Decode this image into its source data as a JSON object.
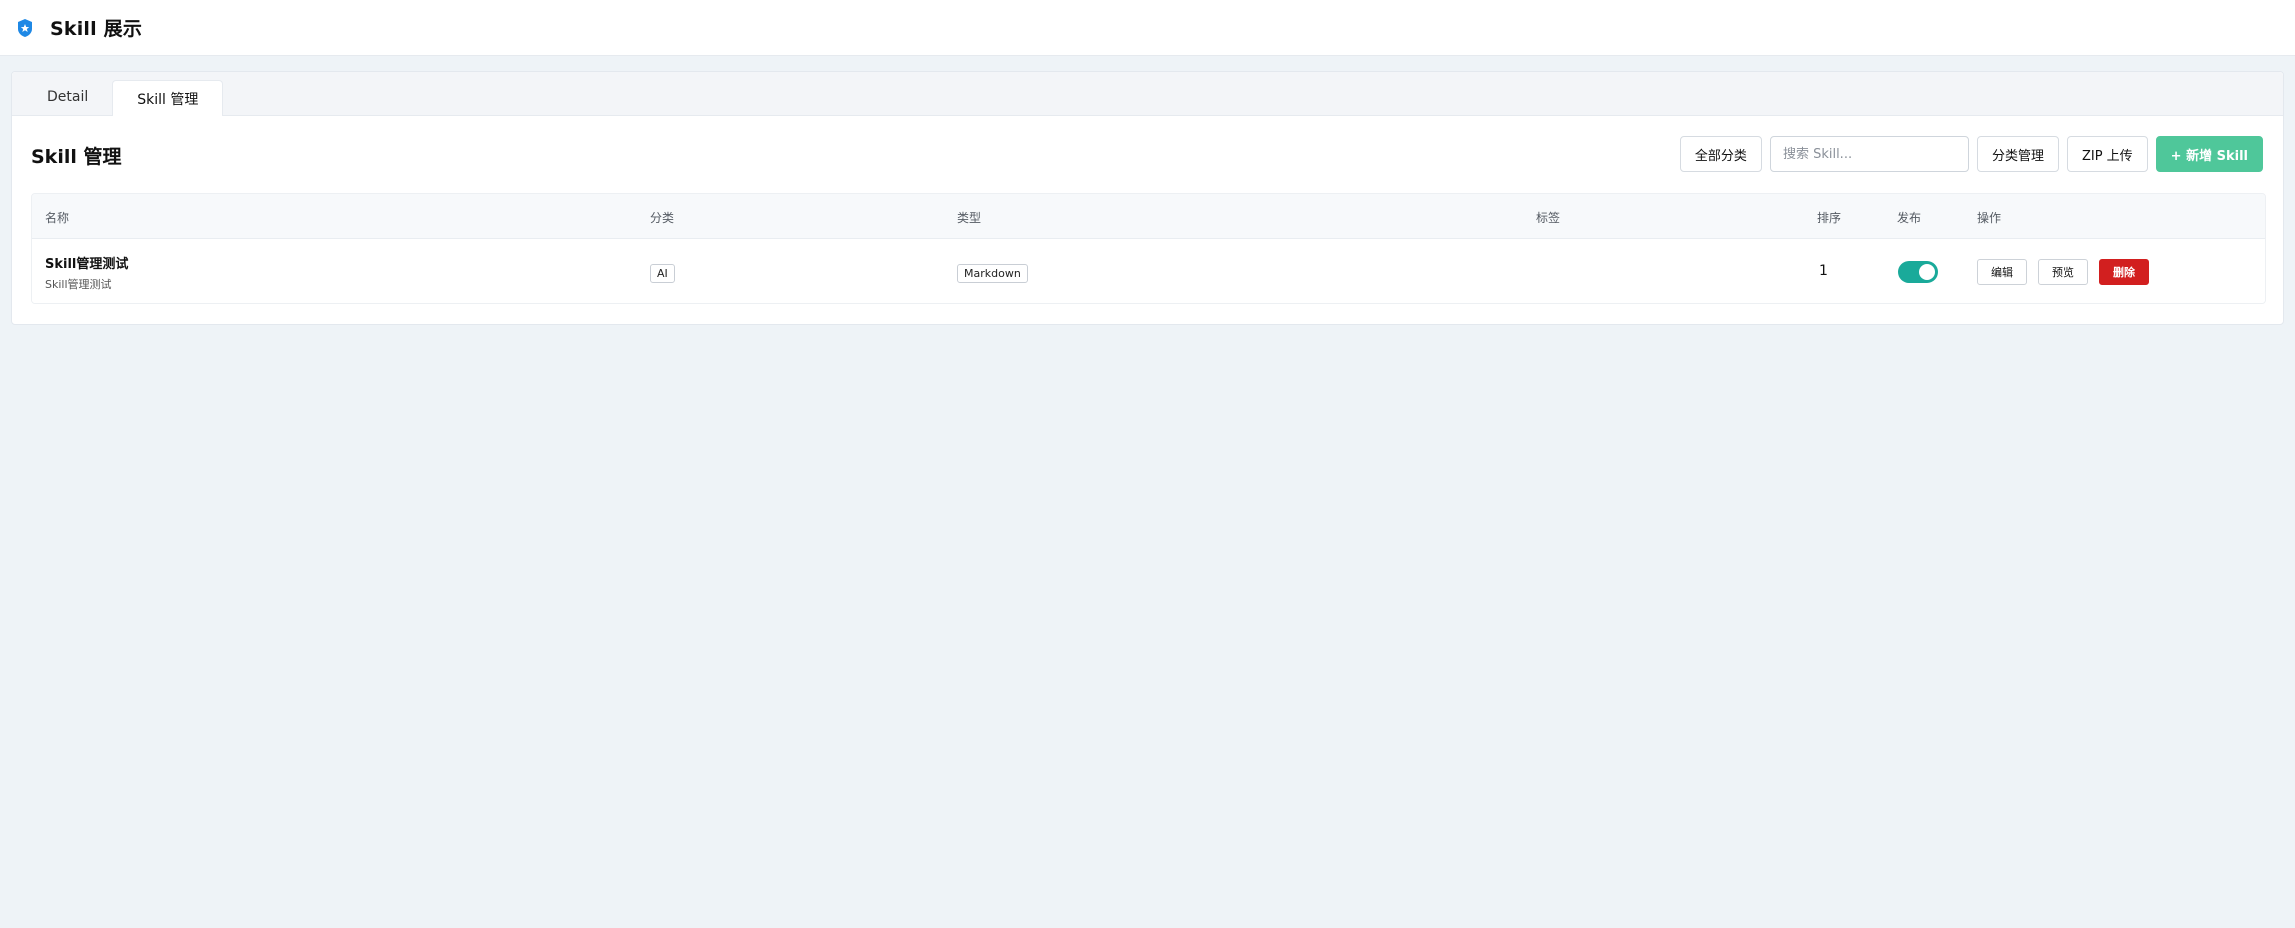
{
  "app": {
    "title": "Skill 展示",
    "icon": "badge-star-icon",
    "accent": "#1e88e5"
  },
  "tabs": [
    {
      "label": "Detail",
      "active": false
    },
    {
      "label": "Skill 管理",
      "active": true
    }
  ],
  "section": {
    "title": "Skill 管理"
  },
  "toolbar": {
    "category_filter_label": "全部分类",
    "search_placeholder": "搜索 Skill...",
    "search_value": "",
    "manage_categories_label": "分类管理",
    "zip_upload_label": "ZIP 上传",
    "add_skill_label": "+ 新增 Skill",
    "primary_color": "#4fc79a"
  },
  "table": {
    "columns": [
      "名称",
      "分类",
      "类型",
      "标签",
      "排序",
      "发布",
      "操作"
    ],
    "rows": [
      {
        "name": "Skill管理测试",
        "description": "Skill管理测试",
        "category": "AI",
        "type": "Markdown",
        "tags": "",
        "order": "1",
        "published": true,
        "actions": {
          "edit": "编辑",
          "preview": "预览",
          "delete": "删除"
        }
      }
    ]
  },
  "colors": {
    "toggle_on": "#1aaa9a",
    "danger": "#d21f1f",
    "background": "#eef3f7"
  }
}
